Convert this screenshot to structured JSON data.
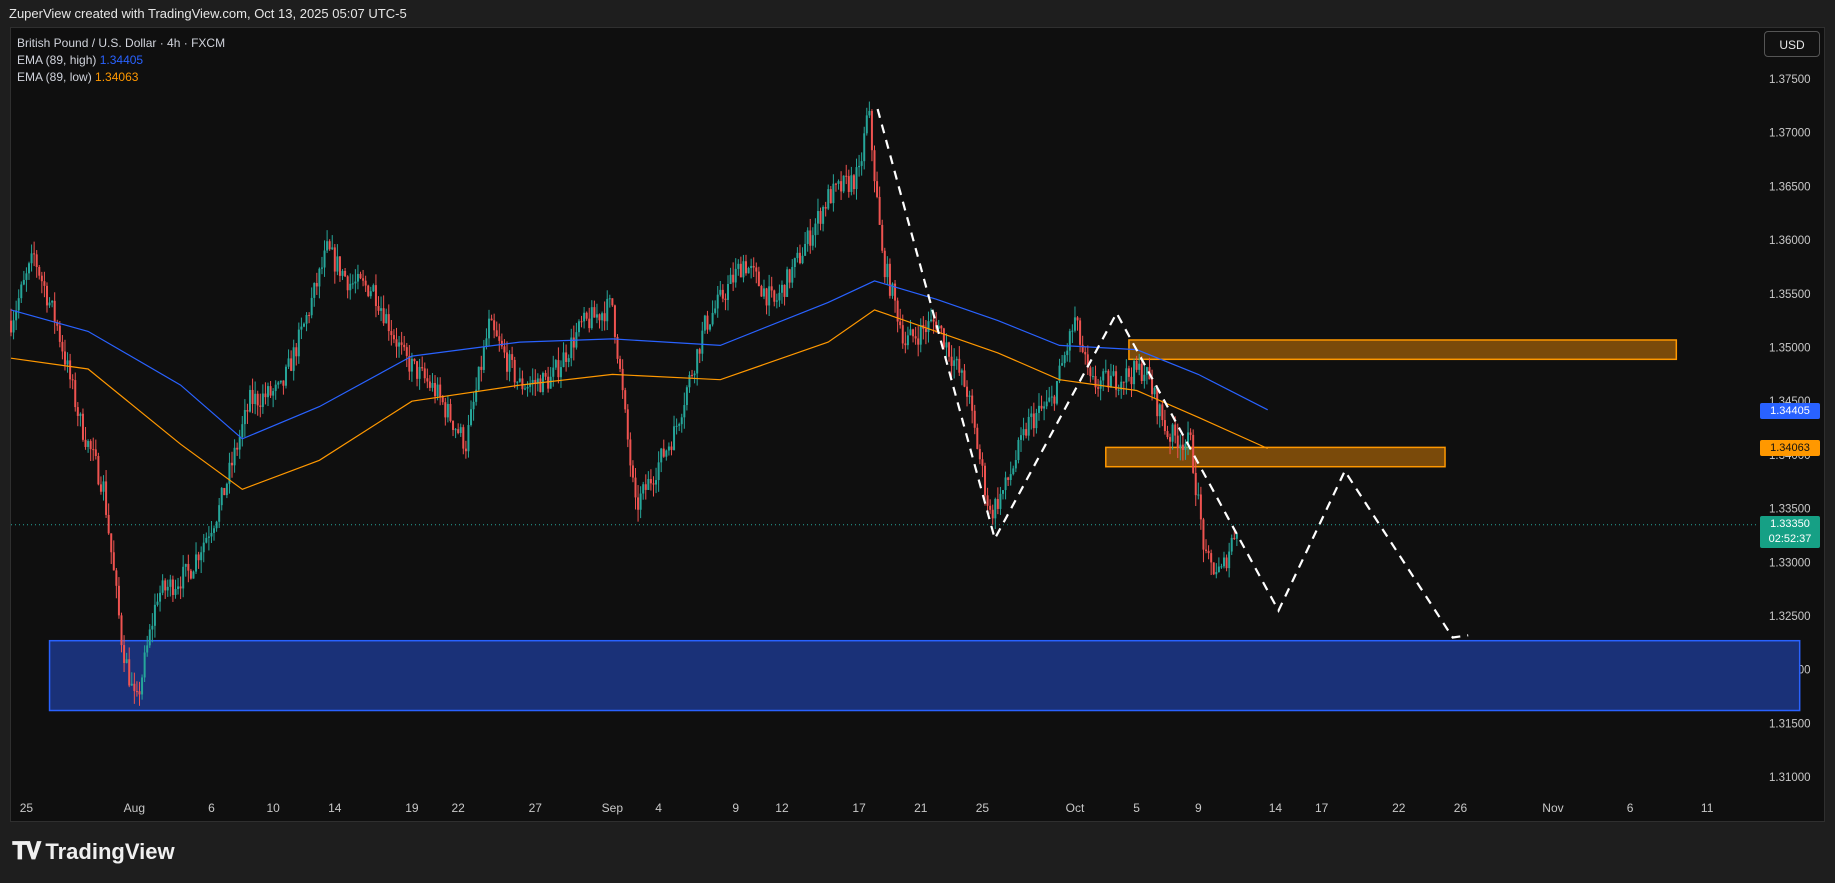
{
  "header": {
    "attribution": "ZuperView created with TradingView.com, Oct 13, 2025 05:07 UTC-5"
  },
  "legend": {
    "symbol": "British Pound / U.S. Dollar · 4h · FXCM",
    "ema_high_label": "EMA (89, high)",
    "ema_high_value": "1.34405",
    "ema_low_label": "EMA (89, low)",
    "ema_low_value": "1.34063"
  },
  "currency_button": "USD",
  "price_tags": {
    "ema_high": "1.34405",
    "ema_low": "1.34063",
    "last_price": "1.33350",
    "countdown": "02:52:37"
  },
  "footer": {
    "brand": "TradingView"
  },
  "colors": {
    "up": "#26a69a",
    "down": "#ef5350",
    "ema_high": "#2962ff",
    "ema_low": "#ff9800",
    "demand_zone": "#1a3178",
    "supply_zone": "#7a4a0a"
  },
  "chart_data": {
    "type": "candlestick",
    "yaxis": {
      "min": 1.308,
      "max": 1.3765,
      "ticks": [
        "1.37500",
        "1.37000",
        "1.36500",
        "1.36000",
        "1.35500",
        "1.35000",
        "1.34500",
        "1.34000",
        "1.33500",
        "1.33000",
        "1.32500",
        "1.32000",
        "1.31500",
        "1.31000"
      ],
      "tick_values": [
        1.375,
        1.37,
        1.365,
        1.36,
        1.355,
        1.35,
        1.345,
        1.34,
        1.335,
        1.33,
        1.325,
        1.32,
        1.315,
        1.31
      ]
    },
    "xaxis": {
      "labels": [
        "25",
        "Aug",
        "6",
        "10",
        "14",
        "19",
        "22",
        "27",
        "Sep",
        "4",
        "9",
        "12",
        "17",
        "21",
        "25",
        "Oct",
        "5",
        "9",
        "14",
        "17",
        "22",
        "26",
        "Nov",
        "6",
        "11"
      ],
      "label_days": [
        -7,
        0,
        5,
        9,
        13,
        18,
        21,
        26,
        31,
        34,
        39,
        42,
        47,
        51,
        55,
        61,
        65,
        69,
        74,
        77,
        82,
        86,
        92,
        97,
        102
      ],
      "start_day": -8,
      "end_day": 104
    },
    "price_path": [
      [
        -8,
        1.3525
      ],
      [
        -6.5,
        1.3585
      ],
      [
        -5,
        1.352
      ],
      [
        -3.5,
        1.343
      ],
      [
        -2,
        1.337
      ],
      [
        -0.8,
        1.3225
      ],
      [
        0.1,
        1.3165
      ],
      [
        1.5,
        1.327
      ],
      [
        3.5,
        1.329
      ],
      [
        5.5,
        1.335
      ],
      [
        7.5,
        1.345
      ],
      [
        9.5,
        1.346
      ],
      [
        11,
        1.352
      ],
      [
        12.5,
        1.359
      ],
      [
        14,
        1.356
      ],
      [
        15.5,
        1.3555
      ],
      [
        17.5,
        1.349
      ],
      [
        19.5,
        1.346
      ],
      [
        21.5,
        1.341
      ],
      [
        23,
        1.352
      ],
      [
        25,
        1.3465
      ],
      [
        27,
        1.347
      ],
      [
        29,
        1.352
      ],
      [
        31,
        1.354
      ],
      [
        32.5,
        1.335
      ],
      [
        35,
        1.342
      ],
      [
        37,
        1.352
      ],
      [
        39.5,
        1.358
      ],
      [
        41.5,
        1.354
      ],
      [
        43,
        1.358
      ],
      [
        45,
        1.364
      ],
      [
        47,
        1.366
      ],
      [
        47.6,
        1.3722
      ],
      [
        48.5,
        1.3585
      ],
      [
        50,
        1.3505
      ],
      [
        52,
        1.3525
      ],
      [
        54,
        1.346
      ],
      [
        55.5,
        1.3345
      ],
      [
        56.5,
        1.337
      ],
      [
        58,
        1.343
      ],
      [
        59.5,
        1.345
      ],
      [
        61,
        1.3525
      ],
      [
        62,
        1.3465
      ],
      [
        63.5,
        1.347
      ],
      [
        65.5,
        1.348
      ],
      [
        67,
        1.342
      ],
      [
        68.5,
        1.341
      ],
      [
        69.5,
        1.33
      ],
      [
        70.5,
        1.329
      ],
      [
        71.5,
        1.3335
      ]
    ],
    "series": [
      {
        "name": "EMA (89, high)",
        "points": [
          [
            -8,
            1.3535
          ],
          [
            -3,
            1.3515
          ],
          [
            3,
            1.3465
          ],
          [
            7,
            1.3415
          ],
          [
            12,
            1.3445
          ],
          [
            18,
            1.3492
          ],
          [
            25,
            1.3505
          ],
          [
            31,
            1.3508
          ],
          [
            38,
            1.3502
          ],
          [
            45,
            1.3542
          ],
          [
            48,
            1.3562
          ],
          [
            52,
            1.3545
          ],
          [
            56,
            1.3525
          ],
          [
            60,
            1.3502
          ],
          [
            65,
            1.3498
          ],
          [
            69,
            1.3475
          ],
          [
            73.5,
            1.3442
          ]
        ]
      },
      {
        "name": "EMA (89, low)",
        "points": [
          [
            -8,
            1.349
          ],
          [
            -3,
            1.348
          ],
          [
            3,
            1.341
          ],
          [
            7,
            1.3368
          ],
          [
            12,
            1.3395
          ],
          [
            18,
            1.345
          ],
          [
            25,
            1.3465
          ],
          [
            31,
            1.3475
          ],
          [
            38,
            1.347
          ],
          [
            45,
            1.3505
          ],
          [
            48,
            1.3535
          ],
          [
            52,
            1.3515
          ],
          [
            56,
            1.3495
          ],
          [
            60,
            1.347
          ],
          [
            65,
            1.346
          ],
          [
            69,
            1.3435
          ],
          [
            73.5,
            1.3406
          ]
        ]
      }
    ],
    "zones": [
      {
        "type": "demand",
        "x0": -5.5,
        "x1": 108,
        "y0": 1.3162,
        "y1": 1.3227
      },
      {
        "type": "supply",
        "x0": 64.5,
        "x1": 100,
        "y0": 1.3489,
        "y1": 1.3507
      },
      {
        "type": "supply",
        "x0": 63,
        "x1": 85,
        "y0": 1.3389,
        "y1": 1.3407
      }
    ],
    "projection": [
      [
        48.2,
        1.3722
      ],
      [
        55.8,
        1.3322
      ],
      [
        63.7,
        1.3532
      ],
      [
        74.2,
        1.3255
      ],
      [
        78.5,
        1.3385
      ],
      [
        85.5,
        1.323
      ],
      [
        86.5,
        1.3232
      ]
    ],
    "last_price": 1.3335
  }
}
